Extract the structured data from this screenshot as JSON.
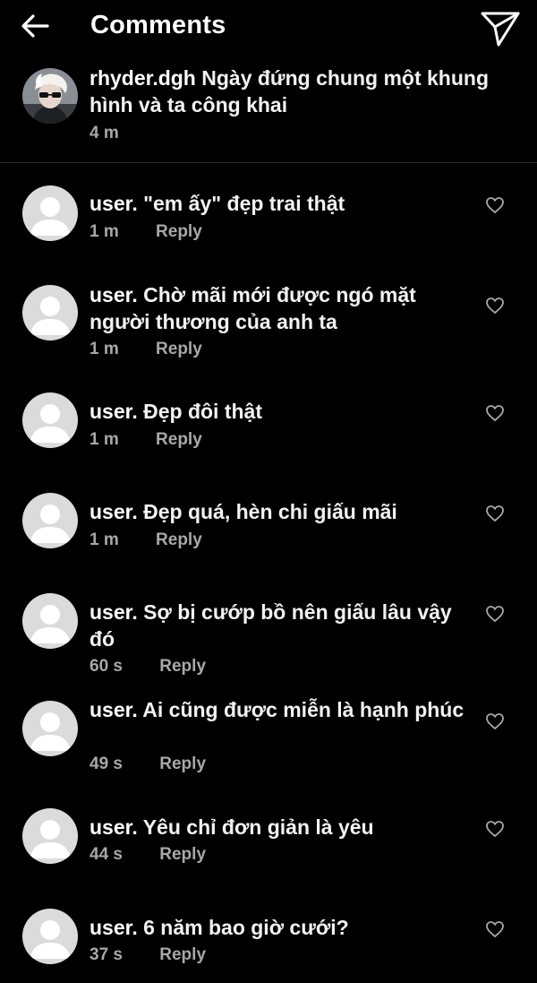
{
  "header": {
    "title": "Comments",
    "back_icon": "arrow-left-icon",
    "share_icon": "paper-plane-icon"
  },
  "caption": {
    "username": "rhyder.dgh",
    "text": "Ngày đứng chung một khung hình và ta công khai",
    "time": "4 m"
  },
  "comments": [
    {
      "username": "user.",
      "text": "\"em ấy\" đẹp trai thật",
      "time": "1 m",
      "reply": "Reply"
    },
    {
      "username": "user.",
      "text": "Chờ mãi mới được ngó mặt người thương của anh ta",
      "time": "1 m",
      "reply": "Reply"
    },
    {
      "username": "user.",
      "text": "Đẹp đôi thật",
      "time": "1 m",
      "reply": "Reply"
    },
    {
      "username": "user.",
      "text": "Đẹp quá, hèn chi giấu mãi",
      "time": "1 m",
      "reply": "Reply"
    },
    {
      "username": "user.",
      "text": "Sợ bị cướp bồ nên giấu lâu vậy đó",
      "time": "60 s",
      "reply": "Reply"
    },
    {
      "username": "user.",
      "text": "Ai cũng được miễn là hạnh phúc",
      "time": "49 s",
      "reply": "Reply"
    },
    {
      "username": "user.",
      "text": "Yêu chỉ đơn giản là yêu",
      "time": "44 s",
      "reply": "Reply"
    },
    {
      "username": "user.",
      "text": "6 năm bao giờ cưới?",
      "time": "37 s",
      "reply": "Reply"
    }
  ],
  "colors": {
    "background": "#000000",
    "text": "#ffffff",
    "meta": "#a8a8a8",
    "avatar_placeholder": "#dbdbdb"
  }
}
